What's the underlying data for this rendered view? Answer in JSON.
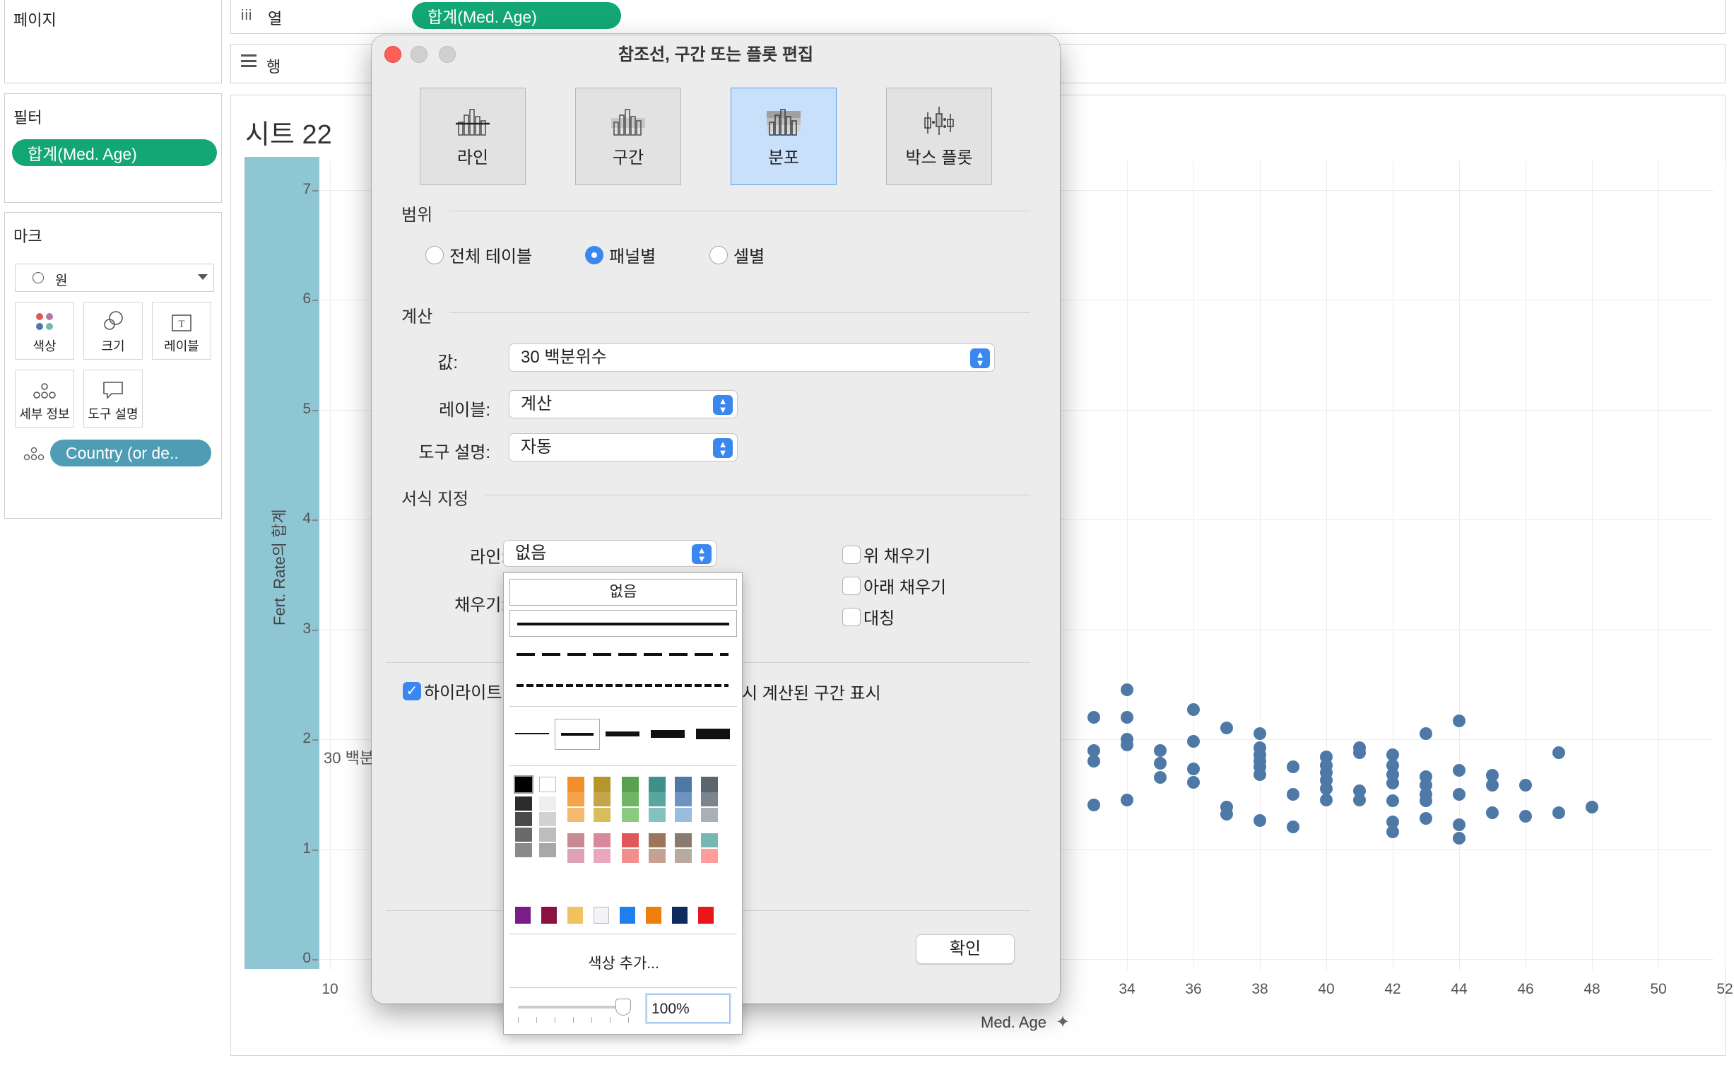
{
  "shelves": {
    "pages": "페이지",
    "columns_label": "열",
    "rows_label": "행",
    "columns_pill": "합계(Med. Age)"
  },
  "filters": {
    "title": "필터",
    "pill": "합계(Med. Age)"
  },
  "marks": {
    "title": "마크",
    "mark_type": "원",
    "buttons": [
      {
        "label": "색상",
        "icon": "color-icon"
      },
      {
        "label": "크기",
        "icon": "size-icon"
      },
      {
        "label": "레이블",
        "icon": "label-icon"
      },
      {
        "label": "세부 정보",
        "icon": "detail-icon"
      },
      {
        "label": "도구 설명",
        "icon": "tooltip-icon"
      }
    ],
    "detail_pill": "Country (or de.."
  },
  "sheet": {
    "title": "시트 22",
    "y_axis_title": "Fert. Rate의 합계",
    "x_axis_title": "Med. Age",
    "ref_band_label": "30 백분"
  },
  "colors": {
    "accent_blue": "#3b87f0",
    "pill_green": "#13a776",
    "pill_blue": "#4f9db4",
    "band": "#8fc6d4",
    "dot": "#4e79a7"
  },
  "chart_data": {
    "type": "scatter",
    "xlabel": "Med. Age",
    "ylabel": "Fert. Rate의 합계",
    "xlim": [
      10,
      52
    ],
    "ylim": [
      0,
      7.3
    ],
    "x_ticks": [
      10,
      34,
      36,
      38,
      40,
      42,
      44,
      46,
      48,
      50,
      52
    ],
    "y_ticks": [
      0,
      1,
      2,
      3,
      4,
      5,
      6,
      7
    ],
    "band": {
      "from": 0,
      "to": 7.3
    },
    "points": [
      [
        33,
        2.2
      ],
      [
        33,
        1.9
      ],
      [
        33,
        1.8
      ],
      [
        33,
        1.4
      ],
      [
        34,
        2.45
      ],
      [
        34,
        2.2
      ],
      [
        34,
        2.0
      ],
      [
        34,
        1.95
      ],
      [
        34,
        1.45
      ],
      [
        35,
        1.9
      ],
      [
        35,
        1.78
      ],
      [
        35,
        1.65
      ],
      [
        36,
        2.27
      ],
      [
        36,
        1.98
      ],
      [
        36,
        1.73
      ],
      [
        36,
        1.61
      ],
      [
        37,
        2.1
      ],
      [
        37,
        1.38
      ],
      [
        37,
        1.32
      ],
      [
        38,
        2.05
      ],
      [
        38,
        1.92
      ],
      [
        38,
        1.86
      ],
      [
        38,
        1.8
      ],
      [
        38,
        1.75
      ],
      [
        38,
        1.68
      ],
      [
        38,
        1.26
      ],
      [
        39,
        1.75
      ],
      [
        39,
        1.5
      ],
      [
        39,
        1.2
      ],
      [
        40,
        1.84
      ],
      [
        40,
        1.76
      ],
      [
        40,
        1.7
      ],
      [
        40,
        1.63
      ],
      [
        40,
        1.55
      ],
      [
        40,
        1.45
      ],
      [
        41,
        1.92
      ],
      [
        41,
        1.88
      ],
      [
        41,
        1.53
      ],
      [
        41,
        1.45
      ],
      [
        42,
        1.86
      ],
      [
        42,
        1.76
      ],
      [
        42,
        1.68
      ],
      [
        42,
        1.6
      ],
      [
        42,
        1.44
      ],
      [
        42,
        1.25
      ],
      [
        42,
        1.16
      ],
      [
        43,
        2.05
      ],
      [
        43,
        1.66
      ],
      [
        43,
        1.58
      ],
      [
        43,
        1.5
      ],
      [
        43,
        1.44
      ],
      [
        43,
        1.28
      ],
      [
        44,
        2.17
      ],
      [
        44,
        1.72
      ],
      [
        44,
        1.5
      ],
      [
        44,
        1.22
      ],
      [
        44,
        1.1
      ],
      [
        45,
        1.67
      ],
      [
        45,
        1.58
      ],
      [
        45,
        1.33
      ],
      [
        46,
        1.58
      ],
      [
        46,
        1.3
      ],
      [
        47,
        1.88
      ],
      [
        47,
        1.33
      ],
      [
        48,
        1.38
      ]
    ]
  },
  "dialog": {
    "title": "참조선, 구간 또는 플롯 편집",
    "types": [
      {
        "label": "라인",
        "icon": "reference-line-icon",
        "selected": false
      },
      {
        "label": "구간",
        "icon": "reference-band-icon",
        "selected": false
      },
      {
        "label": "분포",
        "icon": "distribution-icon",
        "selected": true
      },
      {
        "label": "박스 플롯",
        "icon": "box-plot-icon",
        "selected": false
      }
    ],
    "scope_title": "범위",
    "scope_options": [
      {
        "label": "전체 테이블",
        "selected": false
      },
      {
        "label": "패널별",
        "selected": true
      },
      {
        "label": "셀별",
        "selected": false
      }
    ],
    "calc_title": "계산",
    "value_label": "값:",
    "value": "30 백분위수",
    "label_label": "레이블:",
    "label_value": "계산",
    "tooltip_label": "도구 설명:",
    "tooltip_value": "자동",
    "format_title": "서식 지정",
    "line_label": "라인:",
    "line_value": "없음",
    "fill_label": "채우기:",
    "fill_above": "위 채우기",
    "fill_below": "아래 채우기",
    "symmetric": "대칭",
    "highlight_left": "하이라이트",
    "highlight_right": "시 계산된 구간 표시",
    "ok": "확인"
  },
  "line_popup": {
    "none": "없음",
    "add_color": "색상 추가...",
    "opacity": "100%"
  }
}
